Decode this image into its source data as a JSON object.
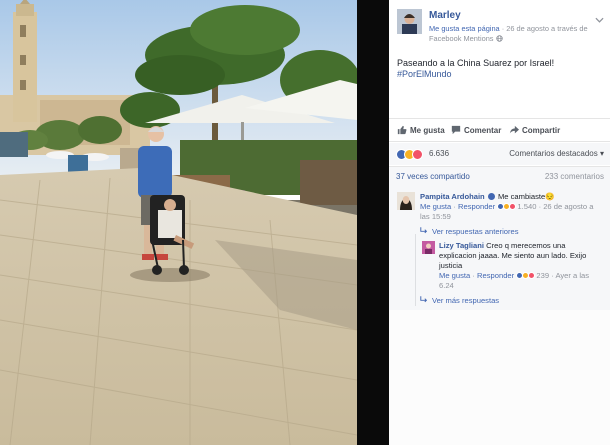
{
  "post": {
    "author": "Marley",
    "meta_line1": "Me gusta esta página",
    "meta_sep": " · ",
    "meta_date": "26 de agosto a través de",
    "meta_source": "Facebook Mentions",
    "meta_globe": "·",
    "text": "Paseando a la China Suarez por Israel!",
    "hashtag": "#PorElMundo"
  },
  "actions": {
    "like": "Me gusta",
    "comment": "Comentar",
    "share": "Compartir"
  },
  "reactions": {
    "count": "6.636",
    "sort_label": "Comentarios destacados",
    "sort_caret": "▾"
  },
  "stats": {
    "shares": "37 veces compartido",
    "comments": "233 comentarios"
  },
  "comments": [
    {
      "name": "Pampita Ardohain",
      "text": "Me cambiaste",
      "emoji": "😔",
      "like": "Me gusta",
      "reply": "Responder",
      "count": "1.540",
      "time": "26 de agosto a las 15:59",
      "more_replies": "Ver respuestas anteriores"
    },
    {
      "name": "Lizy Tagliani",
      "text": "Creo q merecemos una explicacion jaaaa. Me siento aun lado. Exijo justicia",
      "like": "Me gusta",
      "reply": "Responder",
      "count": "239",
      "time": "Ayer a las 6.24",
      "more_replies": "Ver más respuestas"
    }
  ],
  "colors": {
    "link": "#365899",
    "like_blue": "#4267b2",
    "love_red": "#f25268",
    "haha_yellow": "#f7b125"
  }
}
